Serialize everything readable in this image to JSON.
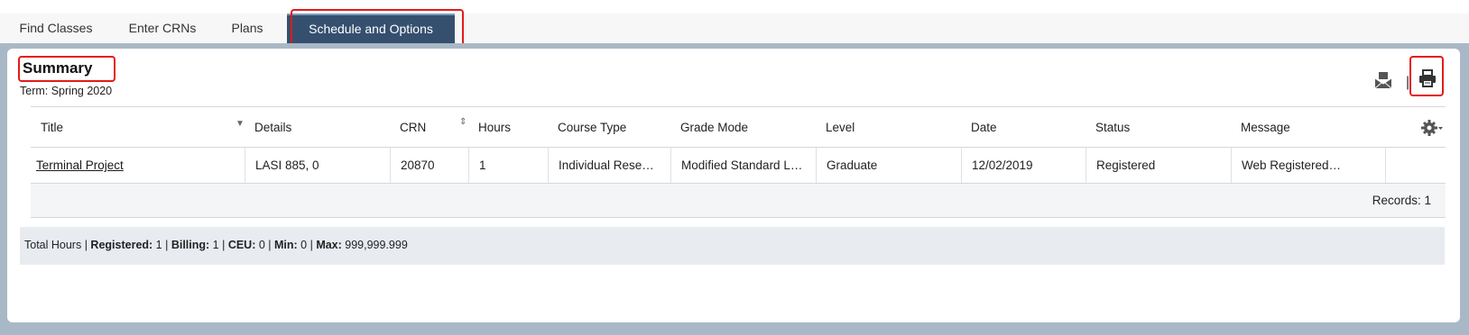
{
  "tabs": [
    {
      "label": "Find Classes"
    },
    {
      "label": "Enter CRNs"
    },
    {
      "label": "Plans"
    },
    {
      "label": "Schedule and Options",
      "active": true
    }
  ],
  "summary": {
    "title": "Summary",
    "term": "Term:  Spring 2020"
  },
  "icons": {
    "email": "email-icon",
    "separator": "|",
    "print": "print-icon",
    "settings": "gear-icon"
  },
  "table": {
    "columns": [
      "Title",
      "Details",
      "CRN",
      "Hours",
      "Course Type",
      "Grade Mode",
      "Level",
      "Date",
      "Status",
      "Message"
    ],
    "rows": [
      {
        "title": "Terminal Project",
        "details": "LASI 885, 0",
        "crn": "20870",
        "hours": "1",
        "course_type": "Individual Rese…",
        "grade_mode": "Modified Standard L…",
        "level": "Graduate",
        "date": "12/02/2019",
        "status": "Registered",
        "message": "Web Registered…"
      }
    ],
    "records": "Records: 1"
  },
  "totals": {
    "prefix": "Total Hours | ",
    "registered_label": "Registered:",
    "registered_value": " 1 | ",
    "billing_label": "Billing:",
    "billing_value": " 1 | ",
    "ceu_label": "CEU:",
    "ceu_value": " 0 | ",
    "min_label": "Min:",
    "min_value": " 0 | ",
    "max_label": "Max:",
    "max_value": " 999,999.999"
  },
  "colors": {
    "active_tab": "#35506f",
    "frame": "#a9b8c6",
    "highlight": "#e41a1a"
  }
}
